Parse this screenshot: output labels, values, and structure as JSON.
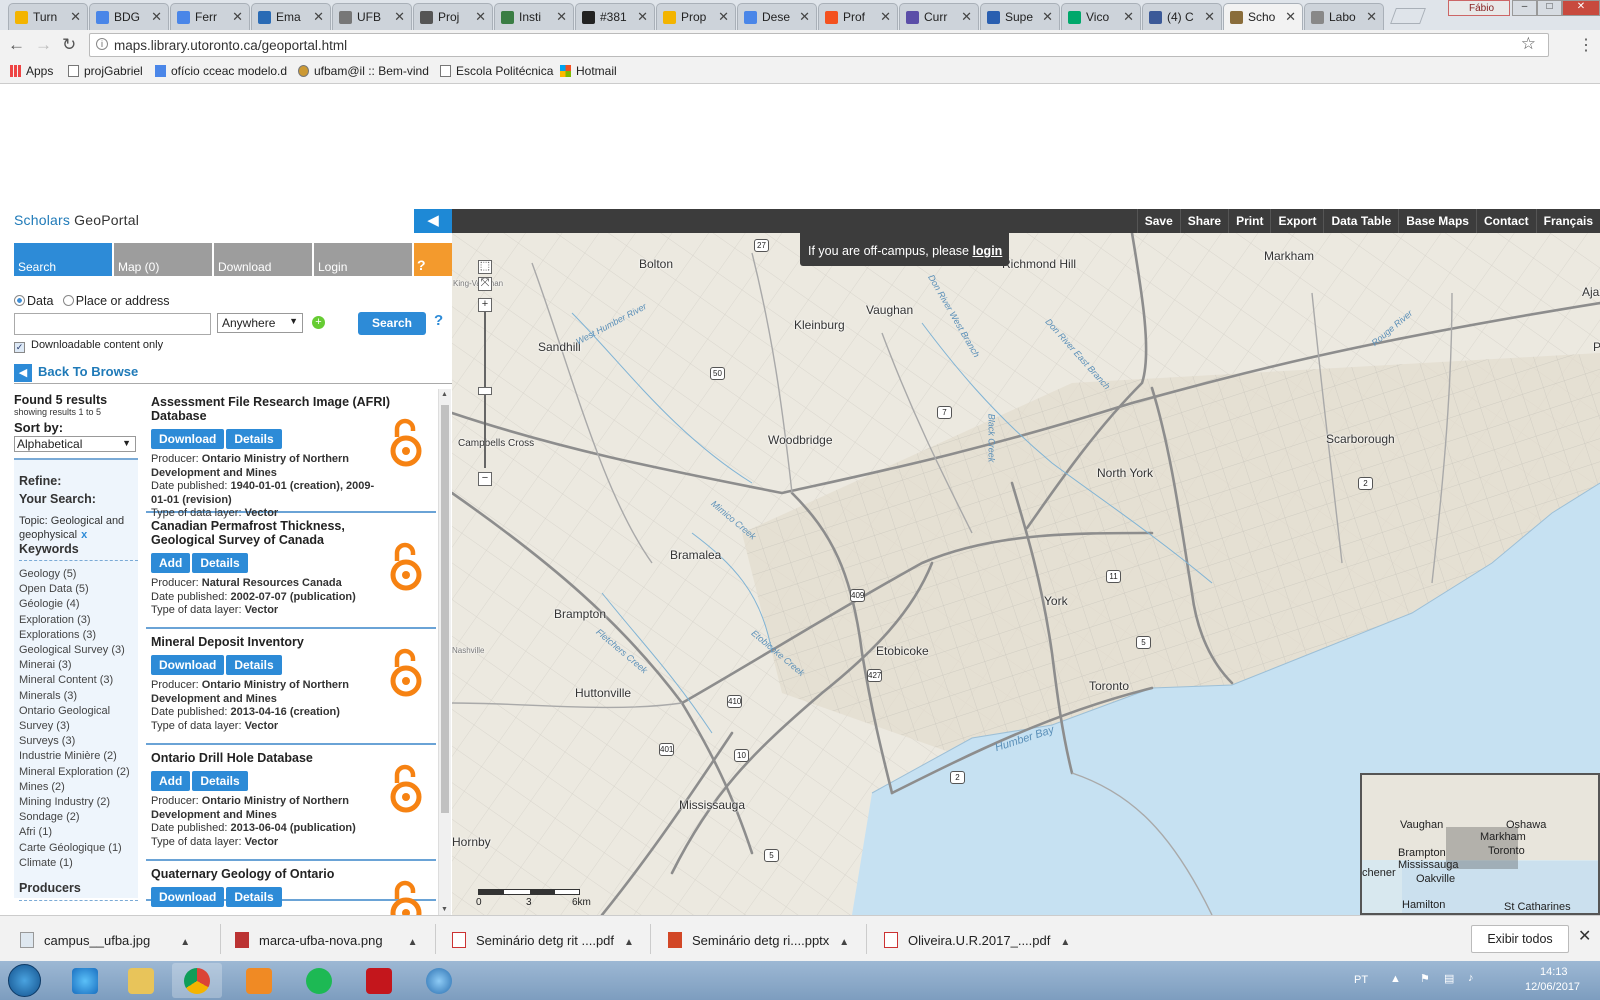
{
  "browser": {
    "tabs": [
      {
        "label": "Turn",
        "color": "#f3b400"
      },
      {
        "label": "BDG",
        "color": "#4a86e8"
      },
      {
        "label": "Ferr",
        "color": "#4a86e8"
      },
      {
        "label": "Ema",
        "color": "#2a6bb5"
      },
      {
        "label": "UFB",
        "color": "#777777"
      },
      {
        "label": "Proj",
        "color": "#555555"
      },
      {
        "label": "Insti",
        "color": "#3a7d44"
      },
      {
        "label": "#381",
        "color": "#222222"
      },
      {
        "label": "Prop",
        "color": "#f3b400"
      },
      {
        "label": "Dese",
        "color": "#4a86e8"
      },
      {
        "label": "Prof",
        "color": "#f4511e"
      },
      {
        "label": "Curr",
        "color": "#5b4ea8"
      },
      {
        "label": "Supe",
        "color": "#2a5fb0"
      },
      {
        "label": "Vico",
        "color": "#00a86b"
      },
      {
        "label": "(4) C",
        "color": "#3b5998"
      },
      {
        "label": "Scho",
        "color": "#8a6d3b"
      },
      {
        "label": "Labo",
        "color": "#888888"
      }
    ],
    "profile_name": "Fábio",
    "url": "maps.library.utoronto.ca/geoportal.html",
    "bookmarks": [
      {
        "label": "Apps"
      },
      {
        "label": "projGabriel"
      },
      {
        "label": "ofício cceac modelo.d"
      },
      {
        "label": "ufbam@il :: Bem-vind"
      },
      {
        "label": "Escola Politécnica"
      },
      {
        "label": "Hotmail"
      }
    ]
  },
  "app": {
    "logo_part1": "Scholars ",
    "logo_part2": "GeoPortal",
    "top_menu": [
      "Save",
      "Share",
      "Print",
      "Export",
      "Data Table",
      "Base Maps",
      "Contact",
      "Français"
    ],
    "side_tabs": [
      {
        "label": "Search"
      },
      {
        "label": "Map (0)"
      },
      {
        "label": "Download"
      },
      {
        "label": "Login"
      }
    ],
    "help_tab": "?",
    "search": {
      "radio_data": "Data",
      "radio_place": "Place or address",
      "query_value": "",
      "scope": "Anywhere",
      "button": "Search",
      "help": "?",
      "downloadable_only": "Downloadable content only"
    },
    "back_to_browse": "Back To Browse",
    "results_summary": {
      "found": "Found 5 results",
      "showing": "showing results 1 to 5",
      "sort_by": "Sort by:",
      "sort_value": "Alphabetical"
    },
    "refine": {
      "title1": "Refine:",
      "title2": "Your Search:",
      "topic_line1": "Topic: Geological and",
      "topic_line2": "geophysical",
      "remove": "x",
      "keywords_head": "Keywords",
      "keywords": [
        "Geology (5)",
        "Open Data (5)",
        "Géologie (4)",
        "Exploration (3)",
        "Explorations (3)",
        "Geological Survey (3)",
        "Minerai (3)",
        "Mineral Content (3)",
        "Minerals (3)",
        "Ontario Geological",
        "Survey (3)",
        "Surveys (3)",
        "Industrie Minière (2)",
        "Mineral Exploration (2)",
        "Mines (2)",
        "Mining Industry (2)",
        "Sondage (2)",
        "Afri (1)",
        "Carte Géologique (1)",
        "Climate (1)"
      ],
      "producers_head": "Producers"
    },
    "results": [
      {
        "title": "Assessment File Research Image (AFRI) Database",
        "primary": "Download",
        "secondary": "Details",
        "producer_label": "Producer: ",
        "producer": "Ontario Ministry of Northern Development and Mines",
        "date_label": "Date published: ",
        "date": "1940-01-01 (creation), 2009-01-01 (revision)",
        "type_label": "Type of data layer: ",
        "type": "Vector"
      },
      {
        "title": "Canadian Permafrost Thickness, Geological Survey of Canada",
        "primary": "Add",
        "secondary": "Details",
        "producer_label": "Producer: ",
        "producer": "Natural Resources Canada",
        "date_label": "Date published: ",
        "date": "2002-07-07 (publication)",
        "type_label": "Type of data layer: ",
        "type": "Vector"
      },
      {
        "title": "Mineral Deposit Inventory",
        "primary": "Download",
        "secondary": "Details",
        "producer_label": "Producer: ",
        "producer": "Ontario Ministry of Northern Development and Mines",
        "date_label": "Date published: ",
        "date": "2013-04-16 (creation)",
        "type_label": "Type of data layer: ",
        "type": "Vector"
      },
      {
        "title": "Ontario Drill Hole Database",
        "primary": "Add",
        "secondary": "Details",
        "producer_label": "Producer: ",
        "producer": "Ontario Ministry of Northern Development and Mines",
        "date_label": "Date published: ",
        "date": "2013-06-04 (publication)",
        "type_label": "Type of data layer: ",
        "type": "Vector"
      },
      {
        "title": "Quaternary Geology of Ontario",
        "primary": "Download",
        "secondary": "Details",
        "producer_label": "",
        "producer": "",
        "date_label": "",
        "date": "",
        "type_label": "",
        "type": ""
      }
    ],
    "offcampus_text": "If you are off-campus, please ",
    "offcampus_link": "login",
    "zoom_plus": "+",
    "zoom_minus": "−",
    "scale_labels": [
      "0",
      "3",
      "6km"
    ]
  },
  "map": {
    "places": [
      {
        "name": "Bolton"
      },
      {
        "name": "Richmond Hill"
      },
      {
        "name": "Markham"
      },
      {
        "name": "Vaughan"
      },
      {
        "name": "Kleinburg"
      },
      {
        "name": "Sandhill"
      },
      {
        "name": "Pickering"
      },
      {
        "name": "Woodbridge"
      },
      {
        "name": "Scarborough"
      },
      {
        "name": "North York"
      },
      {
        "name": "Bramalea"
      },
      {
        "name": "Brampton"
      },
      {
        "name": "York"
      },
      {
        "name": "Etobicoke"
      },
      {
        "name": "Toronto"
      },
      {
        "name": "Huttonville"
      },
      {
        "name": "Mississauga"
      },
      {
        "name": "Hornby"
      },
      {
        "name": "Campbells Cross"
      },
      {
        "name": "Ajax"
      },
      {
        "name": "King-Vaughan"
      },
      {
        "name": "Nashville"
      }
    ],
    "roads": [
      "27",
      "50",
      "7",
      "409",
      "11",
      "427",
      "2",
      "5",
      "401",
      "410",
      "10",
      "2",
      "5"
    ],
    "rivers": [
      "West Humber River",
      "Don River East Branch",
      "Humber Bay",
      "Mimico Creek",
      "Etobicoke Creek",
      "Fletchers Creek",
      "Rouge River",
      "Don River West Branch",
      "Black Creek"
    ],
    "overview_labels": [
      "Vaughan",
      "Oshawa",
      "Markham",
      "Toronto",
      "Brampton",
      "Mississauga",
      "Oakville",
      "Hamilton",
      "St Catharines",
      "chener"
    ]
  },
  "downloads": {
    "items": [
      {
        "name": "campus__ufba.jpg"
      },
      {
        "name": "marca-ufba-nova.png"
      },
      {
        "name": "Seminário detg rit ....pdf"
      },
      {
        "name": "Seminário detg ri....pptx"
      },
      {
        "name": "Oliveira.U.R.2017_....pdf"
      }
    ],
    "show_all": "Exibir todos"
  },
  "taskbar": {
    "lang": "PT",
    "time": "14:13",
    "date": "12/06/2017"
  },
  "colors": {
    "accent": "#2d8bd7",
    "help": "#f39a2d",
    "topbar": "#3c3c3c",
    "oa_orange": "#f68212",
    "water": "#c6e1f2",
    "land": "#ece9e0"
  }
}
